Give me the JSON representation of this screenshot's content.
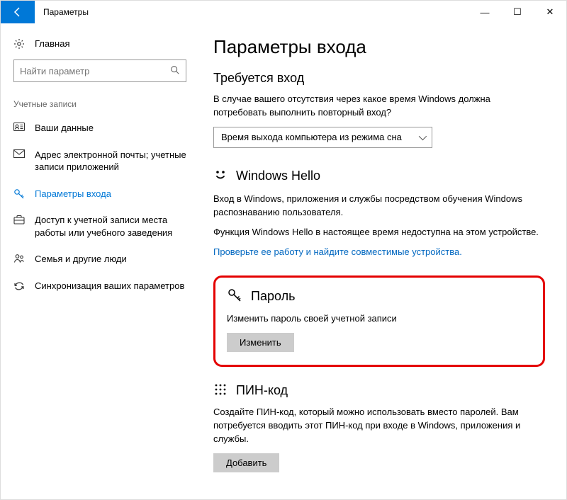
{
  "app_title": "Параметры",
  "window_controls": {
    "min": "—",
    "max": "☐",
    "close": "✕"
  },
  "sidebar": {
    "home_label": "Главная",
    "search_placeholder": "Найти параметр",
    "section_label": "Учетные записи",
    "items": [
      {
        "label": "Ваши данные"
      },
      {
        "label": "Адрес электронной почты; учетные записи приложений"
      },
      {
        "label": "Параметры входа"
      },
      {
        "label": "Доступ к учетной записи места работы или учебного заведения"
      },
      {
        "label": "Семья и другие люди"
      },
      {
        "label": "Синхронизация ваших параметров"
      }
    ]
  },
  "main": {
    "page_title": "Параметры входа",
    "signin_required": {
      "title": "Требуется вход",
      "body": "В случае вашего отсутствия через какое время Windows должна потребовать выполнить повторный вход?",
      "combo_value": "Время выхода компьютера из режима сна"
    },
    "hello": {
      "title": "Windows Hello",
      "desc1": "Вход в Windows, приложения и службы посредством обучения Windows распознаванию пользователя.",
      "desc2": "Функция Windows Hello в настоящее время недоступна на этом устройстве.",
      "link": "Проверьте ее работу и найдите совместимые устройства."
    },
    "password": {
      "title": "Пароль",
      "desc": "Изменить пароль своей учетной записи",
      "button": "Изменить"
    },
    "pin": {
      "title": "ПИН-код",
      "desc": "Создайте ПИН-код, который можно использовать вместо паролей. Вам потребуется вводить этот ПИН-код при входе в Windows, приложения и службы.",
      "button": "Добавить"
    }
  }
}
